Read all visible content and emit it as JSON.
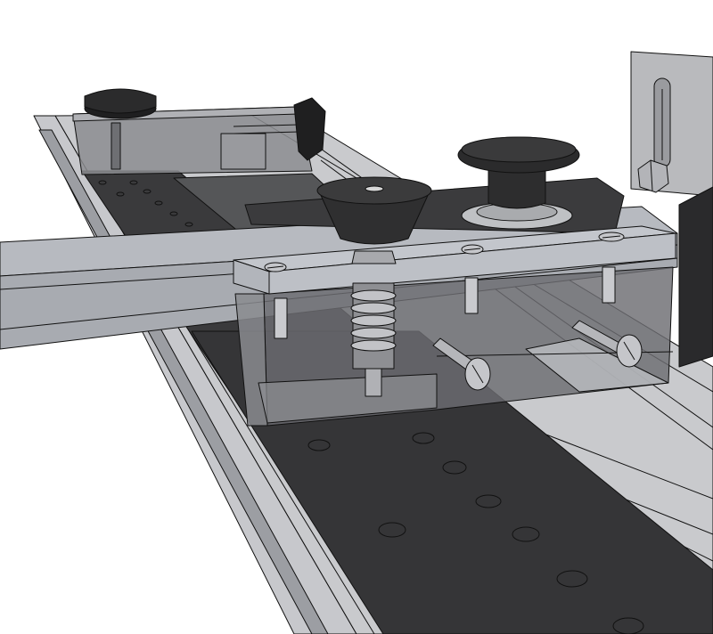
{
  "scene": {
    "kind": "3D CAD render of a sliding fence / stop-block jig on an aluminium track",
    "colors": {
      "background": "#ffffff",
      "track_rail": "#b9babe",
      "track_rail_dark": "#8e9095",
      "perforated_strip": "#3a3a3c",
      "smoked_acrylic": "#6c6d71",
      "clear_acrylic": "#c3c6cc",
      "knob": "#2e2e2f",
      "metal": "#a8a9ad"
    },
    "parts": [
      "track-rail",
      "hole-strip",
      "fence-bar",
      "far-stop-block",
      "far-star-knob",
      "far-side-knob",
      "near-stop-block",
      "top-plate",
      "conical-knob",
      "mushroom-knob",
      "compression-spring",
      "hex-bolt",
      "slotted-screws",
      "upright-bracket"
    ]
  }
}
